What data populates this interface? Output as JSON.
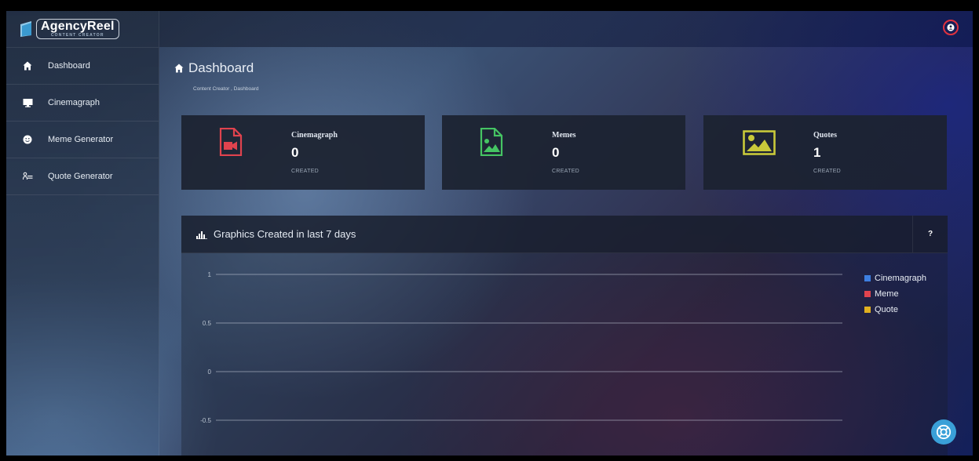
{
  "app": {
    "logo_text": "AgencyReel",
    "logo_sub": "CONTENT CREATOR"
  },
  "sidebar": {
    "items": [
      {
        "label": "Dashboard",
        "icon": "home-icon"
      },
      {
        "label": "Cinemagraph",
        "icon": "monitor-icon"
      },
      {
        "label": "Meme Generator",
        "icon": "smiley-icon"
      },
      {
        "label": "Quote Generator",
        "icon": "quote-icon"
      }
    ]
  },
  "topbar": {
    "user_icon": "user-icon",
    "user_color": "#e0323f"
  },
  "page": {
    "title": "Dashboard",
    "breadcrumb": "Content Creator , Dashboard"
  },
  "cards": [
    {
      "title": "Cinemagraph",
      "value": "0",
      "sub": "CREATED",
      "icon": "video-file-icon",
      "color": "#e0434e"
    },
    {
      "title": "Memes",
      "value": "0",
      "sub": "CREATED",
      "icon": "image-file-icon",
      "color": "#45c463"
    },
    {
      "title": "Quotes",
      "value": "1",
      "sub": "CREATED",
      "icon": "picture-icon",
      "color": "#c9c93a"
    }
  ],
  "chart_panel": {
    "title": "Graphics Created in last 7 days",
    "help_label": "?"
  },
  "chart_data": {
    "type": "line",
    "title": "Graphics Created in last 7 days",
    "y_ticks": [
      "1",
      "0.5",
      "0",
      "-0.5"
    ],
    "ylim": [
      -0.5,
      1
    ],
    "grid": true,
    "legend_position": "right",
    "series": [
      {
        "name": "Cinemagraph",
        "color": "#3d7fe0",
        "values": []
      },
      {
        "name": "Meme",
        "color": "#e0434e",
        "values": []
      },
      {
        "name": "Quote",
        "color": "#e0b020",
        "values": []
      }
    ]
  },
  "support_button": {
    "icon": "lifebuoy-icon",
    "color": "#3aa0d8"
  }
}
